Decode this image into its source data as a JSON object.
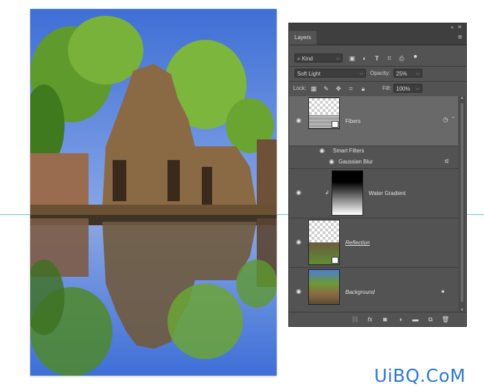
{
  "panel": {
    "tab_label": "Layers",
    "collapse_icon": "double-chevron-icon",
    "close_icon": "close-icon",
    "kind_label": "Kind",
    "blend_mode": "Soft Light",
    "opacity_label": "Opacity:",
    "opacity_value": "25%",
    "lock_label": "Lock:",
    "fill_label": "Fill:",
    "fill_value": "100%"
  },
  "layers": [
    {
      "name": "Fibers",
      "selected": true
    },
    {
      "name": "Smart Filters"
    },
    {
      "name": "Gaussian Blur"
    },
    {
      "name": "Water Gradient"
    },
    {
      "name": "Reflection"
    },
    {
      "name": "Background"
    }
  ],
  "footer_icons": [
    "link-icon",
    "fx-icon",
    "mask-icon",
    "adjustment-icon",
    "folder-icon",
    "new-layer-icon",
    "trash-icon"
  ],
  "watermark": "UiBQ.CoM",
  "colors": {
    "panel_bg": "#535353",
    "selected_layer": "#696969",
    "guide": "#5fc7ee",
    "watermark": "#2f78d8"
  }
}
